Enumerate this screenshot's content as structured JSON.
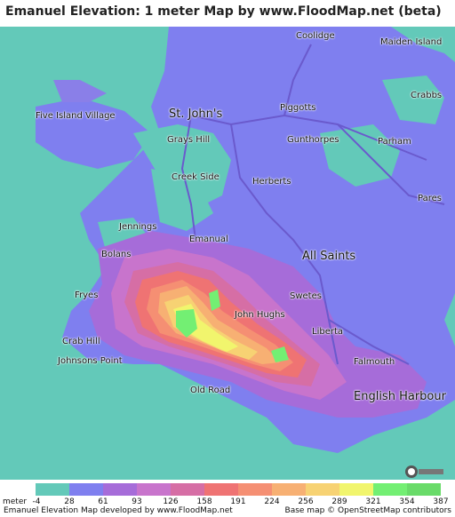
{
  "title": "Emanuel Elevation: 1 meter Map by www.FloodMap.net (beta)",
  "places": [
    {
      "name": "Coolidge",
      "big": false
    },
    {
      "name": "Maiden Island",
      "big": false
    },
    {
      "name": "Crabbs",
      "big": false
    },
    {
      "name": "St. John's",
      "big": true
    },
    {
      "name": "Piggotts",
      "big": false
    },
    {
      "name": "Five Island Village",
      "big": false
    },
    {
      "name": "Grays Hill",
      "big": false
    },
    {
      "name": "Gunthorpes",
      "big": false
    },
    {
      "name": "Parham",
      "big": false
    },
    {
      "name": "Creek Side",
      "big": false
    },
    {
      "name": "Herberts",
      "big": false
    },
    {
      "name": "Pares",
      "big": false
    },
    {
      "name": "Jennings",
      "big": false
    },
    {
      "name": "Emanual",
      "big": false
    },
    {
      "name": "All Saints",
      "big": true
    },
    {
      "name": "Bolans",
      "big": false
    },
    {
      "name": "Fryes",
      "big": false
    },
    {
      "name": "Swetes",
      "big": false
    },
    {
      "name": "John Hughs",
      "big": false
    },
    {
      "name": "Crab Hill",
      "big": false
    },
    {
      "name": "Liberta",
      "big": false
    },
    {
      "name": "Johnsons Point",
      "big": false
    },
    {
      "name": "Falmouth",
      "big": false
    },
    {
      "name": "Old Road",
      "big": false
    },
    {
      "name": "English Harbour",
      "big": true
    }
  ],
  "legend": {
    "unit": "meter",
    "ticks": [
      "-4",
      "28",
      "61",
      "93",
      "126",
      "158",
      "191",
      "224",
      "256",
      "289",
      "321",
      "354",
      "387"
    ],
    "colors": [
      "#63c9b9",
      "#7f7fef",
      "#a66cd9",
      "#c874cc",
      "#d66ea5",
      "#ef7373",
      "#f58f73",
      "#f7b073",
      "#f7d273",
      "#f1f56d",
      "#73ef73",
      "#69db69"
    ]
  },
  "footer": {
    "left": "Emanuel Elevation Map developed by www.FloodMap.net",
    "right": "Base map © OpenStreetMap contributors"
  },
  "osm_badge": "OpenStreetMap"
}
